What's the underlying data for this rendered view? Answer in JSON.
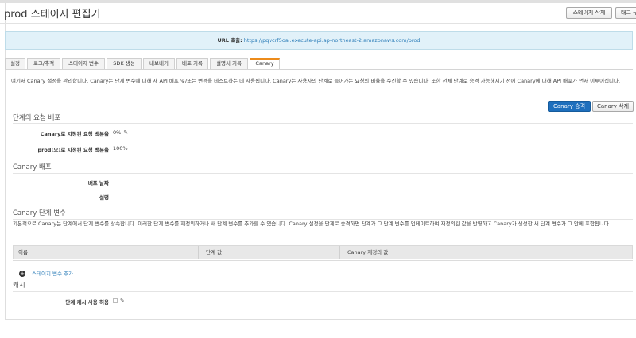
{
  "header": {
    "title": "prod 스테이지 편집기",
    "delete_stage_label": "스테이지 삭제",
    "tag_label": "태그 구"
  },
  "banner": {
    "label": "URL 호출:",
    "url": "https://pqvcrf5oal.execute-api.ap-northeast-2.amazonaws.com/prod"
  },
  "tabs": [
    {
      "label": "설정"
    },
    {
      "label": "로그/추적"
    },
    {
      "label": "스테이지 변수"
    },
    {
      "label": "SDK 생성"
    },
    {
      "label": "내보내기"
    },
    {
      "label": "배포 기록"
    },
    {
      "label": "설명서 기록"
    },
    {
      "label": "Canary"
    }
  ],
  "canary": {
    "description": "여기서 Canary 설정을 관리합니다. Canary는 단계 변수에 대해 새 API 배포 및/또는 변경을 테스트하는 데 사용됩니다. Canary는 사용자의 단계로 들어가는 요청의 비율을 수신할 수 있습니다. 또한 전체 단계로 승격 가능해지기 전에 Canary에 대해 API 배포가 먼저 이루어집니다.",
    "promote_label": "Canary 승격",
    "delete_label": "Canary 삭제"
  },
  "distribution": {
    "heading": "단계의 요청 배포",
    "canary_label": "Canary로 지정된 요청 백분율",
    "canary_value": "0%",
    "prod_label": "prod(으)로 지정된 요청 백분율",
    "prod_value": "100%"
  },
  "deployment": {
    "heading": "Canary 배포",
    "date_label": "배포 날짜",
    "desc_label": "설명"
  },
  "stage_vars": {
    "heading": "Canary 단계 변수",
    "description": "기본적으로 Canary는 단계에서 단계 변수를 상속합니다. 이러한 단계 변수를 재정의하거나 새 단계 변수를 추가할 수 있습니다. Canary 설정을 단계로 승격하면 단계가 그 단계 변수를 업데이트하여 재정의된 값을 반영하고 Canary가 생성한 새 단계 변수가 그 안에 포함됩니다.",
    "columns": [
      "이름",
      "단계 값",
      "Canary 재정의 값"
    ],
    "add_label": "스테이지 변수 추가"
  },
  "cache": {
    "heading": "캐시",
    "enable_label": "단계 캐시 사용 허용"
  }
}
